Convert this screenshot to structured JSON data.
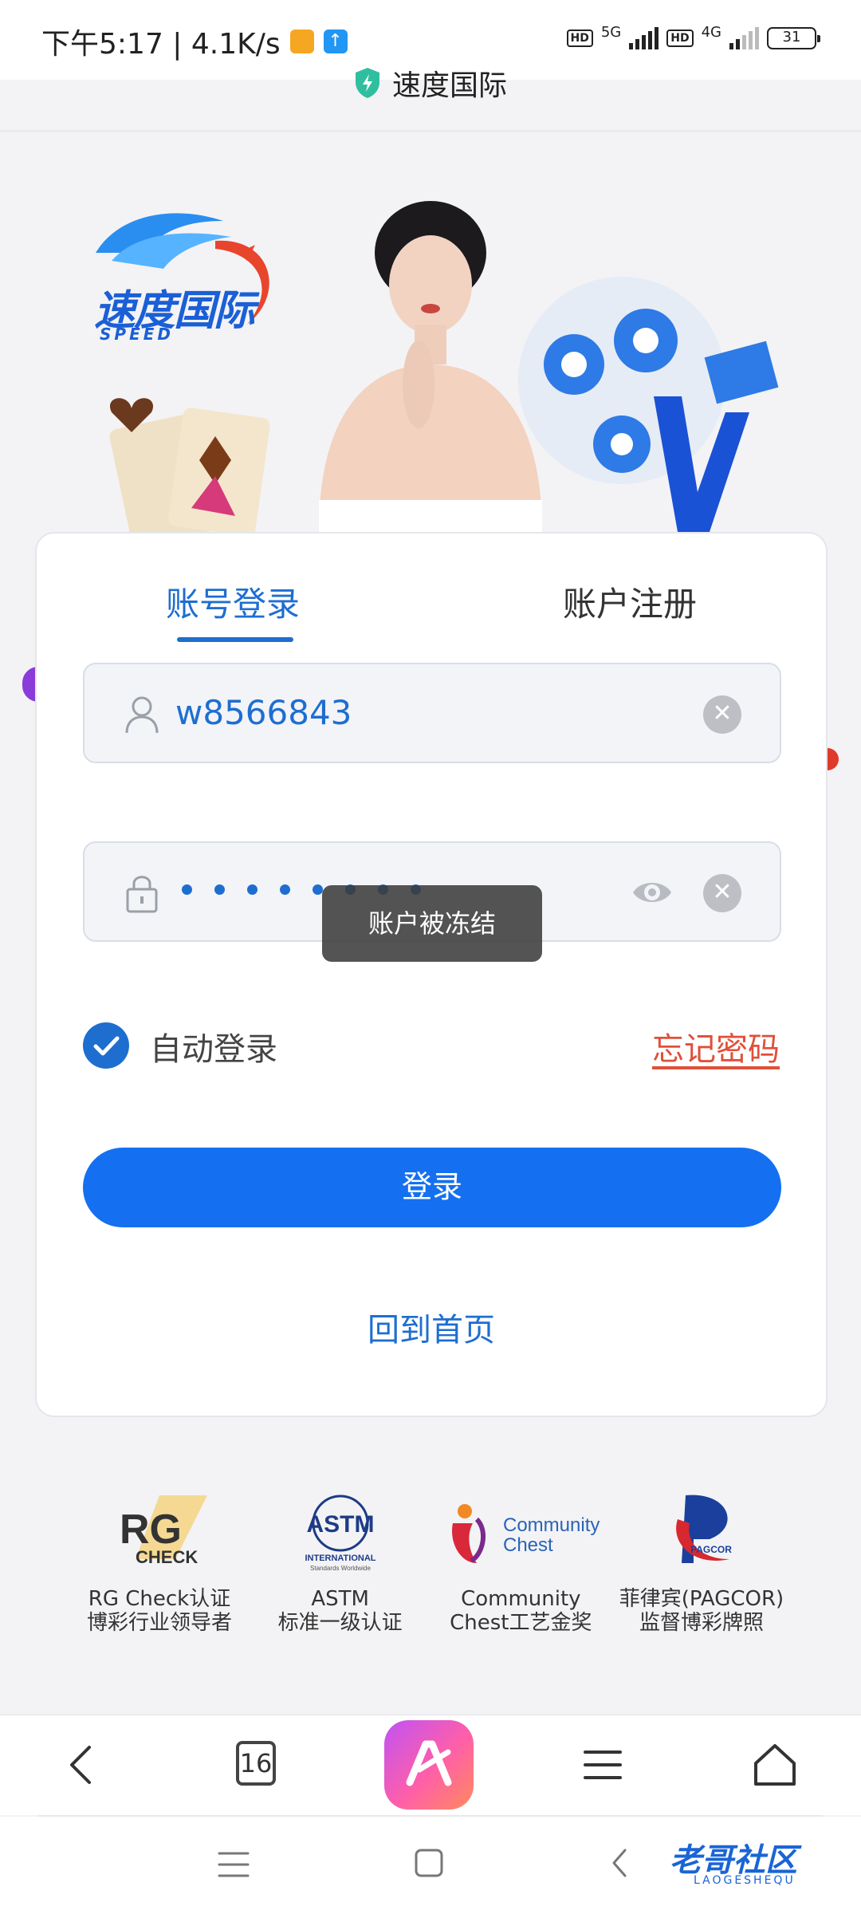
{
  "status_bar": {
    "time_speed": "下午5:17 | 4.1K/s",
    "net1": "5G",
    "net2": "4G",
    "hd": "HD",
    "battery": "31"
  },
  "address_bar": {
    "site_title": "速度国际"
  },
  "banner": {
    "logo_text": "速度国际",
    "logo_sub": "SPEED"
  },
  "login": {
    "tab_login": "账号登录",
    "tab_register": "账户注册",
    "username_value": "w8566843",
    "password_mask_count": 8,
    "auto_login_label": "自动登录",
    "auto_login_checked": true,
    "forgot_password": "忘记密码",
    "login_button": "登录",
    "home_link": "回到首页"
  },
  "toast": {
    "message": "账户被冻结"
  },
  "certifications": [
    {
      "name": "RG Check",
      "line1": "RG Check认证",
      "line2": "博彩行业领导者"
    },
    {
      "name": "ASTM",
      "line1": "ASTM",
      "line2": "标准一级认证"
    },
    {
      "name": "Community Chest",
      "line1": "Community",
      "line2": "Chest工艺金奖"
    },
    {
      "name": "PAGCOR",
      "line1": "菲律宾(PAGCOR)",
      "line2": "监督博彩牌照"
    }
  ],
  "cert_logos": {
    "rg": "RG",
    "rg_check": "CHECK",
    "astm": "ASTM",
    "astm_sub": "INTERNATIONAL",
    "astm_sub2": "Standards Worldwide",
    "community1": "Community",
    "community2": "Chest",
    "pagcor": "PAGCOR"
  },
  "toolbar": {
    "tabs_count": "16"
  },
  "watermark": {
    "text": "老哥社区",
    "sub": "LAOGESHEQU"
  },
  "colors": {
    "primary": "#1470f0",
    "link_blue": "#1e6ed0",
    "forgot_red": "#e0503a"
  }
}
